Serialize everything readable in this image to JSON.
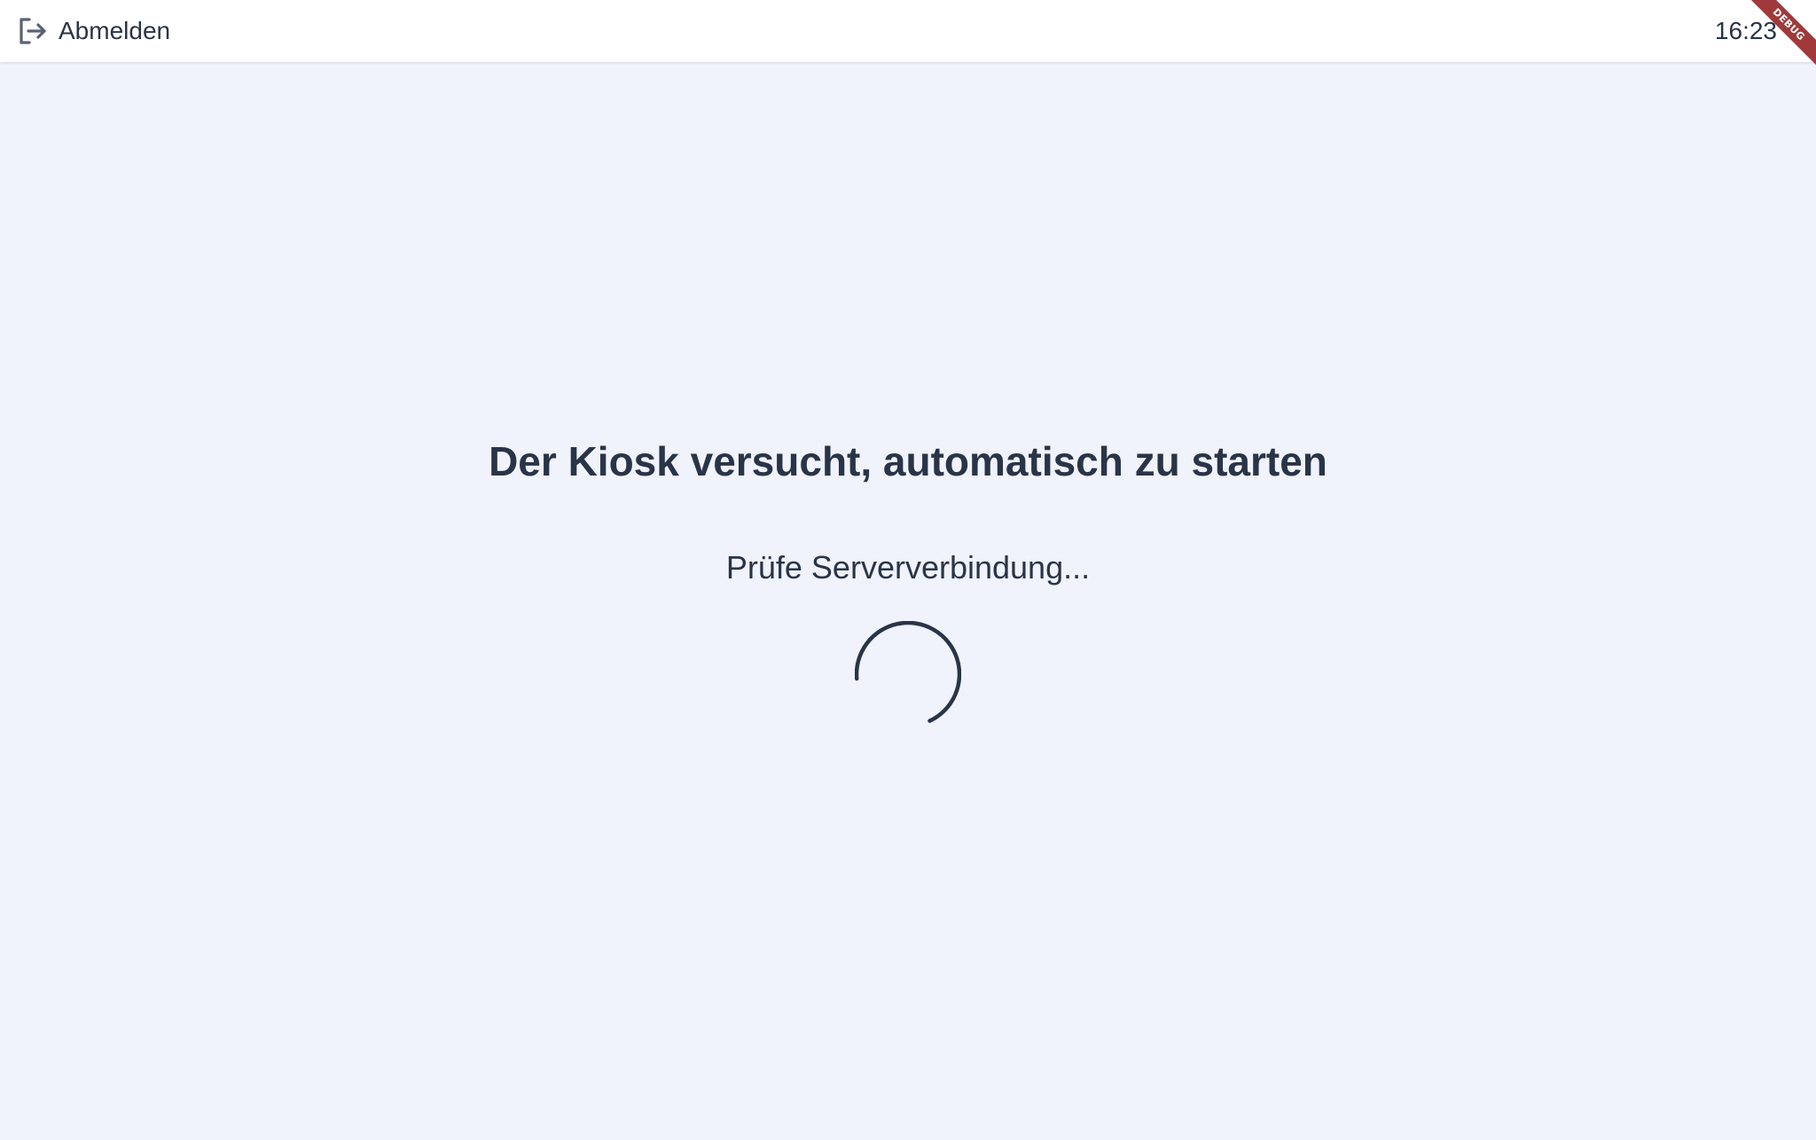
{
  "header": {
    "logout_label": "Abmelden",
    "logout_icon": "logout-icon",
    "clock": "16:23",
    "debug_banner": "DEBUG"
  },
  "main": {
    "title": "Der Kiosk versucht, automatisch zu starten",
    "status": "Prüfe Serververbindung..."
  },
  "colors": {
    "background": "#f0f3fc",
    "header_bg": "#ffffff",
    "text": "#2a3448",
    "debug_banner": "#a03a3a"
  }
}
